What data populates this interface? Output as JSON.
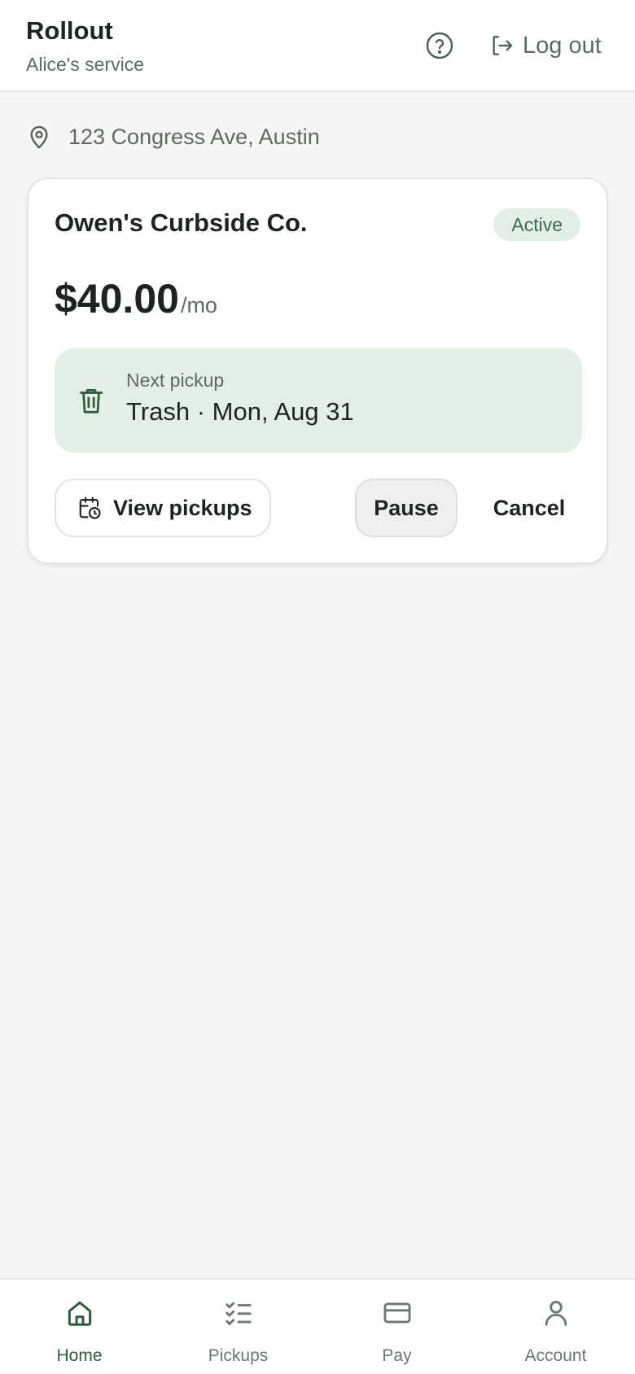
{
  "header": {
    "title": "Rollout",
    "subtitle": "Alice's service",
    "help_icon": "help-circle-icon",
    "logout_label": "Log out"
  },
  "address": {
    "text": "123 Congress Ave, Austin",
    "icon": "map-pin-icon"
  },
  "subscription": {
    "provider": "Owen's Curbside Co.",
    "status": "Active",
    "price": "$40.00",
    "period": "/mo",
    "next_pickup": {
      "label": "Next pickup",
      "value": "Trash · Mon, Aug 31",
      "icon": "trash-icon"
    },
    "actions": {
      "view_pickups": "View pickups",
      "pause": "Pause",
      "cancel": "Cancel"
    }
  },
  "tabbar": {
    "tabs": [
      {
        "label": "Home",
        "icon": "home-icon",
        "active": true
      },
      {
        "label": "Pickups",
        "icon": "checklist-icon",
        "active": false
      },
      {
        "label": "Pay",
        "icon": "card-icon",
        "active": false
      },
      {
        "label": "Account",
        "icon": "user-icon",
        "active": false
      }
    ]
  },
  "colors": {
    "accent": "#2f5a3d",
    "badge_bg": "#e2efe5",
    "muted": "#5c6a62",
    "background": "#f5f5f3"
  }
}
